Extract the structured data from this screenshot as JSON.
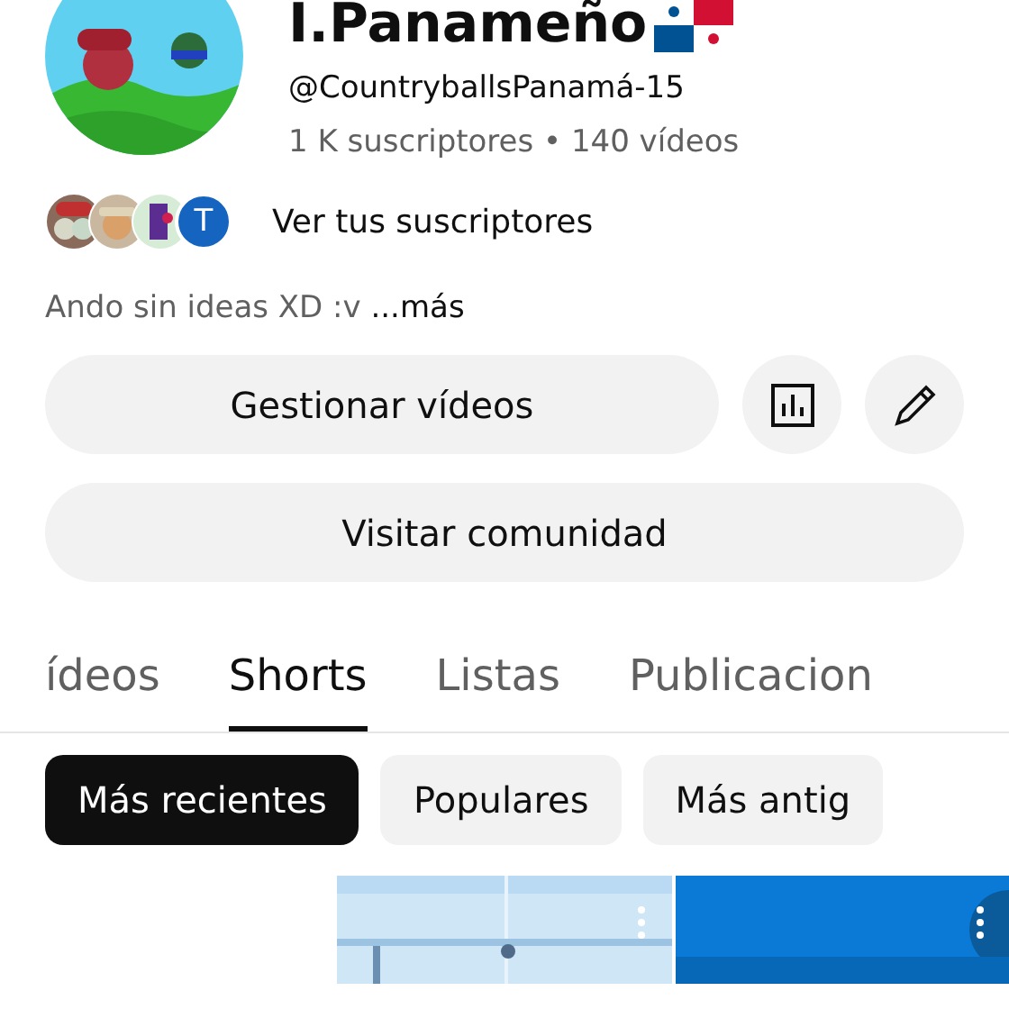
{
  "channel": {
    "title": "I.Panameño",
    "handle": "@CountryballsPanamá-15",
    "stats": "1 K suscriptores • 140 vídeos"
  },
  "subscribers": {
    "avatars": [
      {
        "kind": "picture"
      },
      {
        "kind": "picture"
      },
      {
        "kind": "picture"
      },
      {
        "kind": "letter",
        "letter": "T",
        "color": "#1565c0"
      }
    ],
    "link": "Ver tus suscriptores"
  },
  "description": {
    "text": "Ando sin ideas XD :v",
    "more": "...más"
  },
  "actions": {
    "manage": "Gestionar vídeos",
    "community": "Visitar comunidad"
  },
  "tabs": [
    {
      "label": "ídeos",
      "selected": false
    },
    {
      "label": "Shorts",
      "selected": true
    },
    {
      "label": "Listas",
      "selected": false
    },
    {
      "label": "Publicacion",
      "selected": false
    }
  ],
  "filters": [
    {
      "label": "Más recientes",
      "selected": true
    },
    {
      "label": "Populares",
      "selected": false
    },
    {
      "label": "Más antig",
      "selected": false
    }
  ],
  "shorts": [
    {
      "kind": "picture"
    },
    {
      "kind": "picture"
    }
  ]
}
